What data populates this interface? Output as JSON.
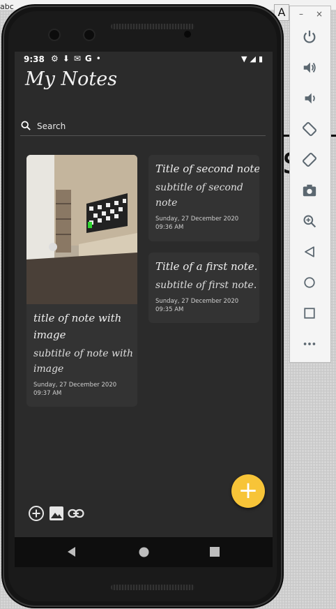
{
  "status": {
    "time": "9:38"
  },
  "app": {
    "title": "My Notes",
    "search_placeholder": "Search"
  },
  "notes": [
    {
      "title": "title of note with image",
      "subtitle": "subtitle of note with image",
      "date": "Sunday, 27 December 2020 09:37 AM",
      "has_image": true
    },
    {
      "title": "Title of second note",
      "subtitle": "subtitle of second note",
      "date": "Sunday, 27 December 2020 09:36 AM"
    },
    {
      "title": "Title of a first note.",
      "subtitle": "subtitle of first note.",
      "date": "Sunday, 27 December 2020 09:35 AM"
    }
  ],
  "host": {
    "left_text": "abc",
    "right_glyph": "A"
  },
  "colors": {
    "fab": "#f7c438",
    "screen_bg": "#2b2b2b",
    "card_bg": "#333333"
  },
  "icons": {
    "bottom_tools": [
      "add-circle-icon",
      "image-icon",
      "link-icon"
    ],
    "emulator": [
      "power-icon",
      "volume-up-icon",
      "volume-down-icon",
      "rotate-left-icon",
      "rotate-right-icon",
      "camera-icon",
      "zoom-icon",
      "back-icon",
      "home-icon",
      "overview-icon",
      "more-icon"
    ]
  }
}
